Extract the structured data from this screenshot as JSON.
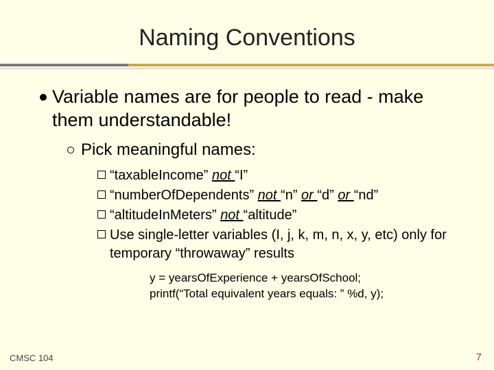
{
  "title": "Naming Conventions",
  "l1": "Variable names are for people to read - make them understandable!",
  "l2": "Pick meaningful names:",
  "b1": {
    "good": "“taxableIncome”",
    "notWord": "not ",
    "bad": "“I”"
  },
  "b2": {
    "good": "“numberOfDependents”",
    "notWord": "not ",
    "bad1": "“n”",
    "or1": "or ",
    "bad2": "“d”",
    "or2": "or ",
    "bad3": "“nd”"
  },
  "b3": {
    "good": "“altitudeInMeters”",
    "notWord": "not ",
    "bad": "“altitude”"
  },
  "b4": "Use single-letter variables (I, j, k, m, n, x, y, etc) only for temporary “throwaway” results",
  "code1": "y = yearsOfExperience + yearsOfSchool;",
  "code2": "printf(“Total equivalent years equals: ” %d, y);",
  "footerLeft": "CMSC 104",
  "footerRight": "7"
}
